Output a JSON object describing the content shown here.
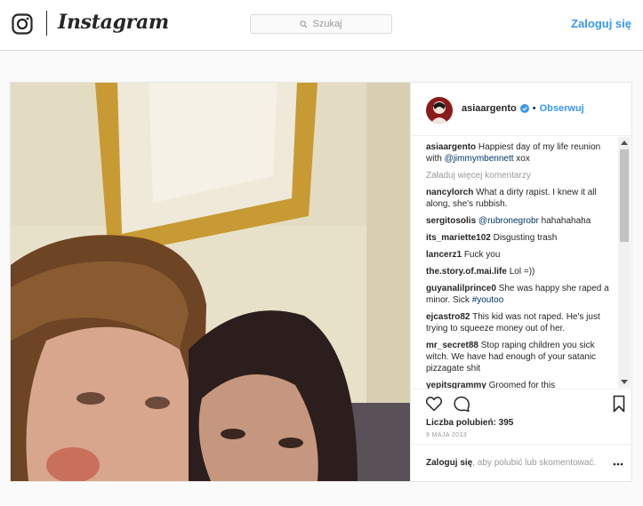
{
  "header": {
    "logo_icon": "instagram-camera-icon",
    "wordmark": "Instagram",
    "search_placeholder": "Szukaj",
    "search_icon": "search-icon",
    "login_label": "Zaloguj się"
  },
  "post": {
    "author": {
      "username": "asiaargento",
      "verified_icon": "verified-badge-icon",
      "separator": "•",
      "follow_label": "Obserwuj"
    },
    "caption": {
      "username": "asiaargento",
      "text_before": "Happiest day of my life reunion with ",
      "mention": "@jimmymbennett",
      "text_after": " xox"
    },
    "load_more_label": "Załaduj więcej komentarzy",
    "comments": [
      {
        "user": "nancylorch",
        "text": "What a dirty rapist. I knew it all along, she's rubbish."
      },
      {
        "user": "sergitosolis",
        "mention": "@rubronegrobr",
        "text": " hahahahaha"
      },
      {
        "user": "its_mariette102",
        "text": "Disgusting trash"
      },
      {
        "user": "lancerz1",
        "text": "Fuck you"
      },
      {
        "user": "the.story.of.mai.life",
        "text": "Lol =))"
      },
      {
        "user": "guyanalilprince0",
        "text": "She was happy she raped a minor. Sick ",
        "tag": "#youtoo"
      },
      {
        "user": "ejcastro82",
        "text": "This kid was not raped. He's just trying to squeeze money out of her."
      },
      {
        "user": "mr_secret88",
        "text": "Stop raping children you sick witch. We have had enough of your satanic pizzagate shit"
      },
      {
        "user": "yepitsgrammy",
        "text": "Groomed for this"
      }
    ],
    "actions": {
      "like_icon": "heart-icon",
      "comment_icon": "comment-bubble-icon",
      "save_icon": "bookmark-icon"
    },
    "likes_label": "Liczba polubień:",
    "likes_count": "395",
    "date": "9 MAJA 2013",
    "footer": {
      "login_label": "Zaloguj się",
      "text": ", aby polubić lub skomentować.",
      "more_icon": "more-options-icon"
    }
  },
  "colors": {
    "accent": "#3897f0",
    "text": "#262626",
    "muted": "#999999",
    "mention": "#003569",
    "border": "#dbdbdb",
    "background": "#fafafa"
  }
}
